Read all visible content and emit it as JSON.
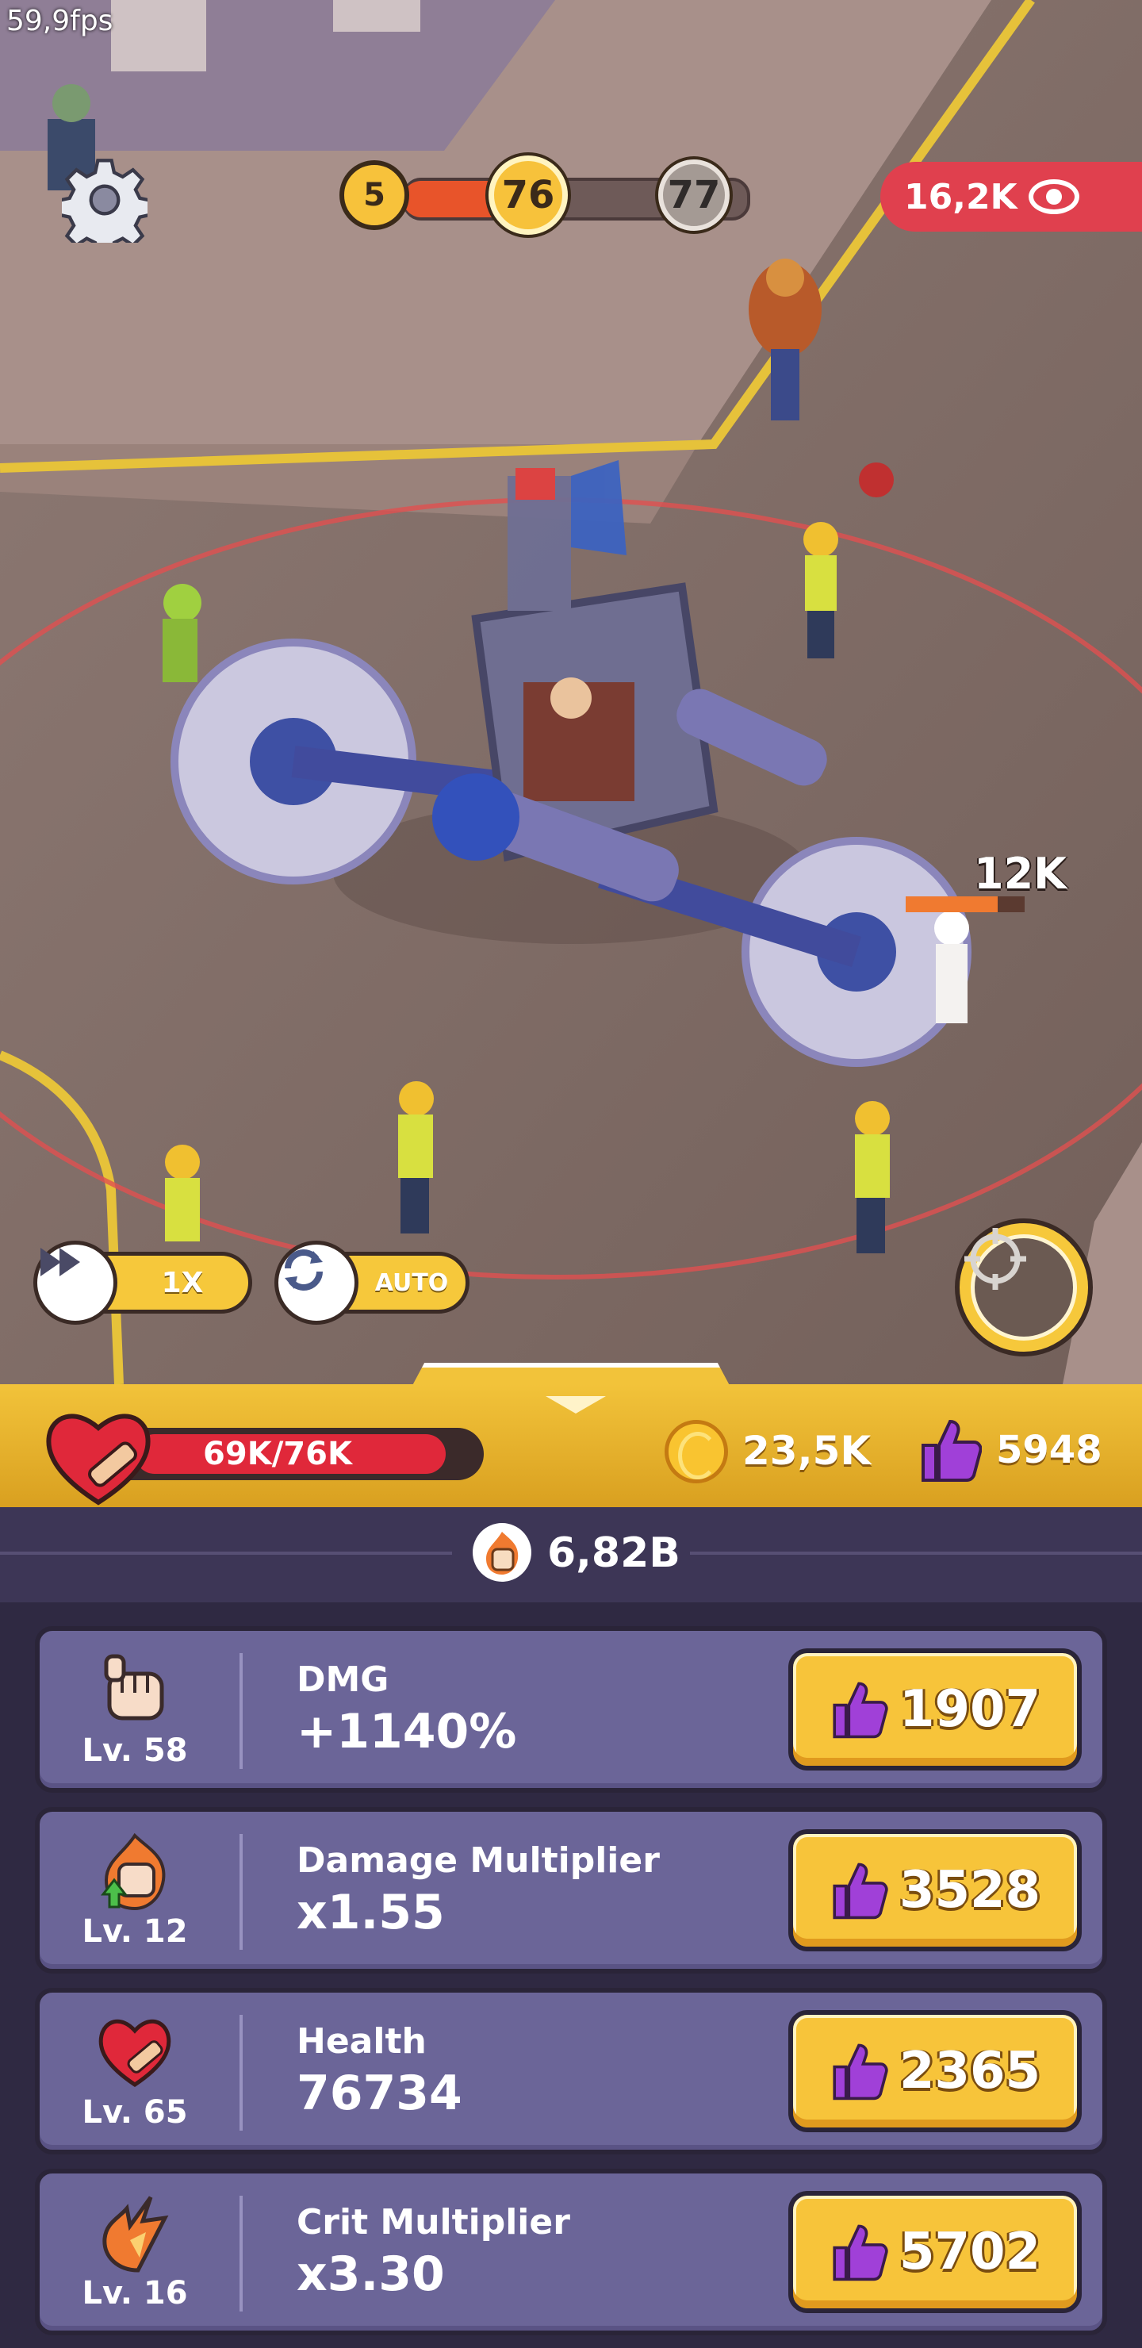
{
  "hud_top": {
    "fps": "59,9fps",
    "level_prev": "5",
    "level_current": "76",
    "level_next": "77",
    "level_progress": 0.45,
    "viewers": "16,2K",
    "viewers_icon": "eye-icon",
    "settings_icon": "gear-icon"
  },
  "battle": {
    "damage_popup": "12K",
    "enemy_health_fraction": 0.77
  },
  "controls": {
    "speed_label": "1X",
    "speed_icon": "fast-forward-icon",
    "auto_label": "AUTO",
    "auto_icon": "refresh-icon",
    "auto_skill_icon": "crosshair-icon"
  },
  "status": {
    "health_text": "69K/76K",
    "health_fraction": 0.907,
    "coins": "23,5K",
    "likes": "5948",
    "colors": {
      "gold": "#f2c33a",
      "health": "#e0283a",
      "panel": "#6b6598",
      "like": "#a040d8"
    }
  },
  "power": {
    "value": "6,82B",
    "icon": "fist-fire-icon"
  },
  "upgrades": [
    {
      "icon": "fist-icon",
      "level": "Lv. 58",
      "name": "DMG",
      "value": "+1140%",
      "price": "1907"
    },
    {
      "icon": "fist-fire-arrow-icon",
      "level": "Lv. 12",
      "name": "Damage Multiplier",
      "value": "x1.55",
      "price": "3528"
    },
    {
      "icon": "heart-bandage-icon",
      "level": "Lv. 65",
      "name": "Health",
      "value": "76734",
      "price": "2365"
    },
    {
      "icon": "crit-flame-icon",
      "level": "Lv. 16",
      "name": "Crit Multiplier",
      "value": "x3.30",
      "price": "5702"
    }
  ]
}
